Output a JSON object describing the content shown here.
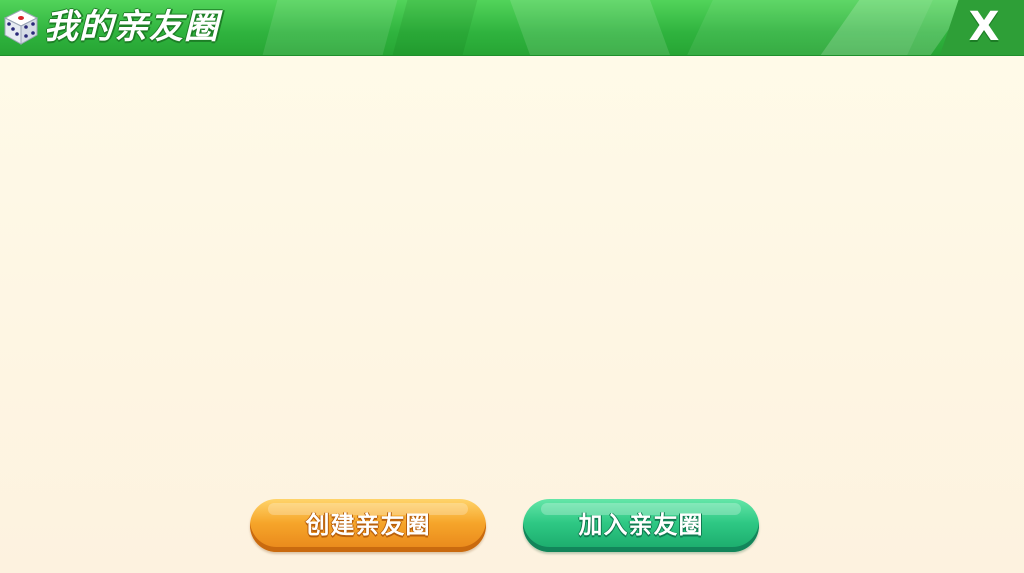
{
  "header": {
    "title": "我的亲友圈",
    "close_label": "X",
    "icon": "dice-icon"
  },
  "actions": {
    "create_label": "创建亲友圈",
    "join_label": "加入亲友圈"
  },
  "colors": {
    "header_green": "#2fb33e",
    "background": "#fdf6e5",
    "create_orange": "#f6a52a",
    "join_green": "#2ec884"
  }
}
